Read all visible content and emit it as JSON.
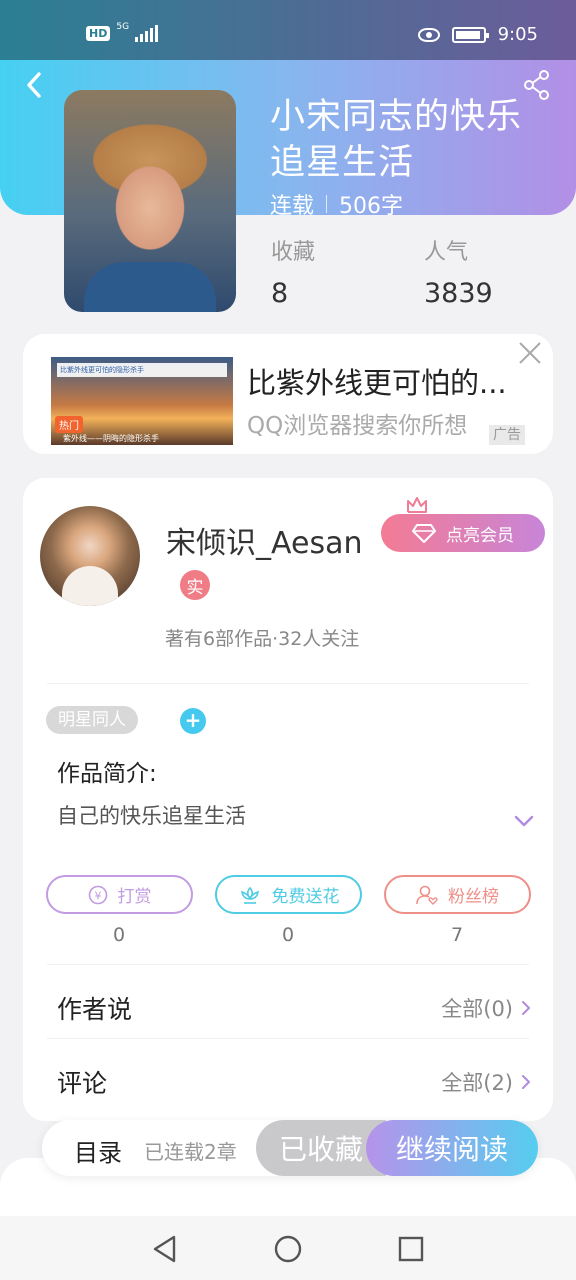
{
  "status_bar": {
    "hd": "HD",
    "network": "5G",
    "time": "9:05"
  },
  "book": {
    "title": "小宋同志的快乐追星生活",
    "status": "连载",
    "word_count": "506字",
    "favorites_label": "收藏",
    "favorites_value": "8",
    "popularity_label": "人气",
    "popularity_value": "3839"
  },
  "ad": {
    "title": "比紫外线更可怕的...",
    "subtitle": "QQ浏览器搜索你所想",
    "tag": "广告",
    "thumb_search": "比紫外线更可怕的隐形杀手",
    "thumb_hot": "热门",
    "thumb_caption": "紫外线——阴晦的隐形杀手"
  },
  "author": {
    "name": "宋倾识_Aesan",
    "vip_label": "点亮会员",
    "verified": "实",
    "stats": "著有6部作品·32人关注"
  },
  "work": {
    "tag": "明星同人",
    "tag_add": "+",
    "intro_label": "作品简介:",
    "intro_text": "自己的快乐追星生活"
  },
  "actions": [
    {
      "label": "打赏",
      "count": "0",
      "color": "#c29be2"
    },
    {
      "label": "免费送花",
      "count": "0",
      "color": "#4fcbe3"
    },
    {
      "label": "粉丝榜",
      "count": "7",
      "color": "#ee8f88"
    }
  ],
  "rows": {
    "author_says": {
      "label": "作者说",
      "right": "全部(0)"
    },
    "comments": {
      "label": "评论",
      "right": "全部(2)"
    }
  },
  "read_bar": {
    "toc": "目录",
    "status": "已连载2章",
    "favorited": "已收藏",
    "continue": "继续阅读"
  }
}
